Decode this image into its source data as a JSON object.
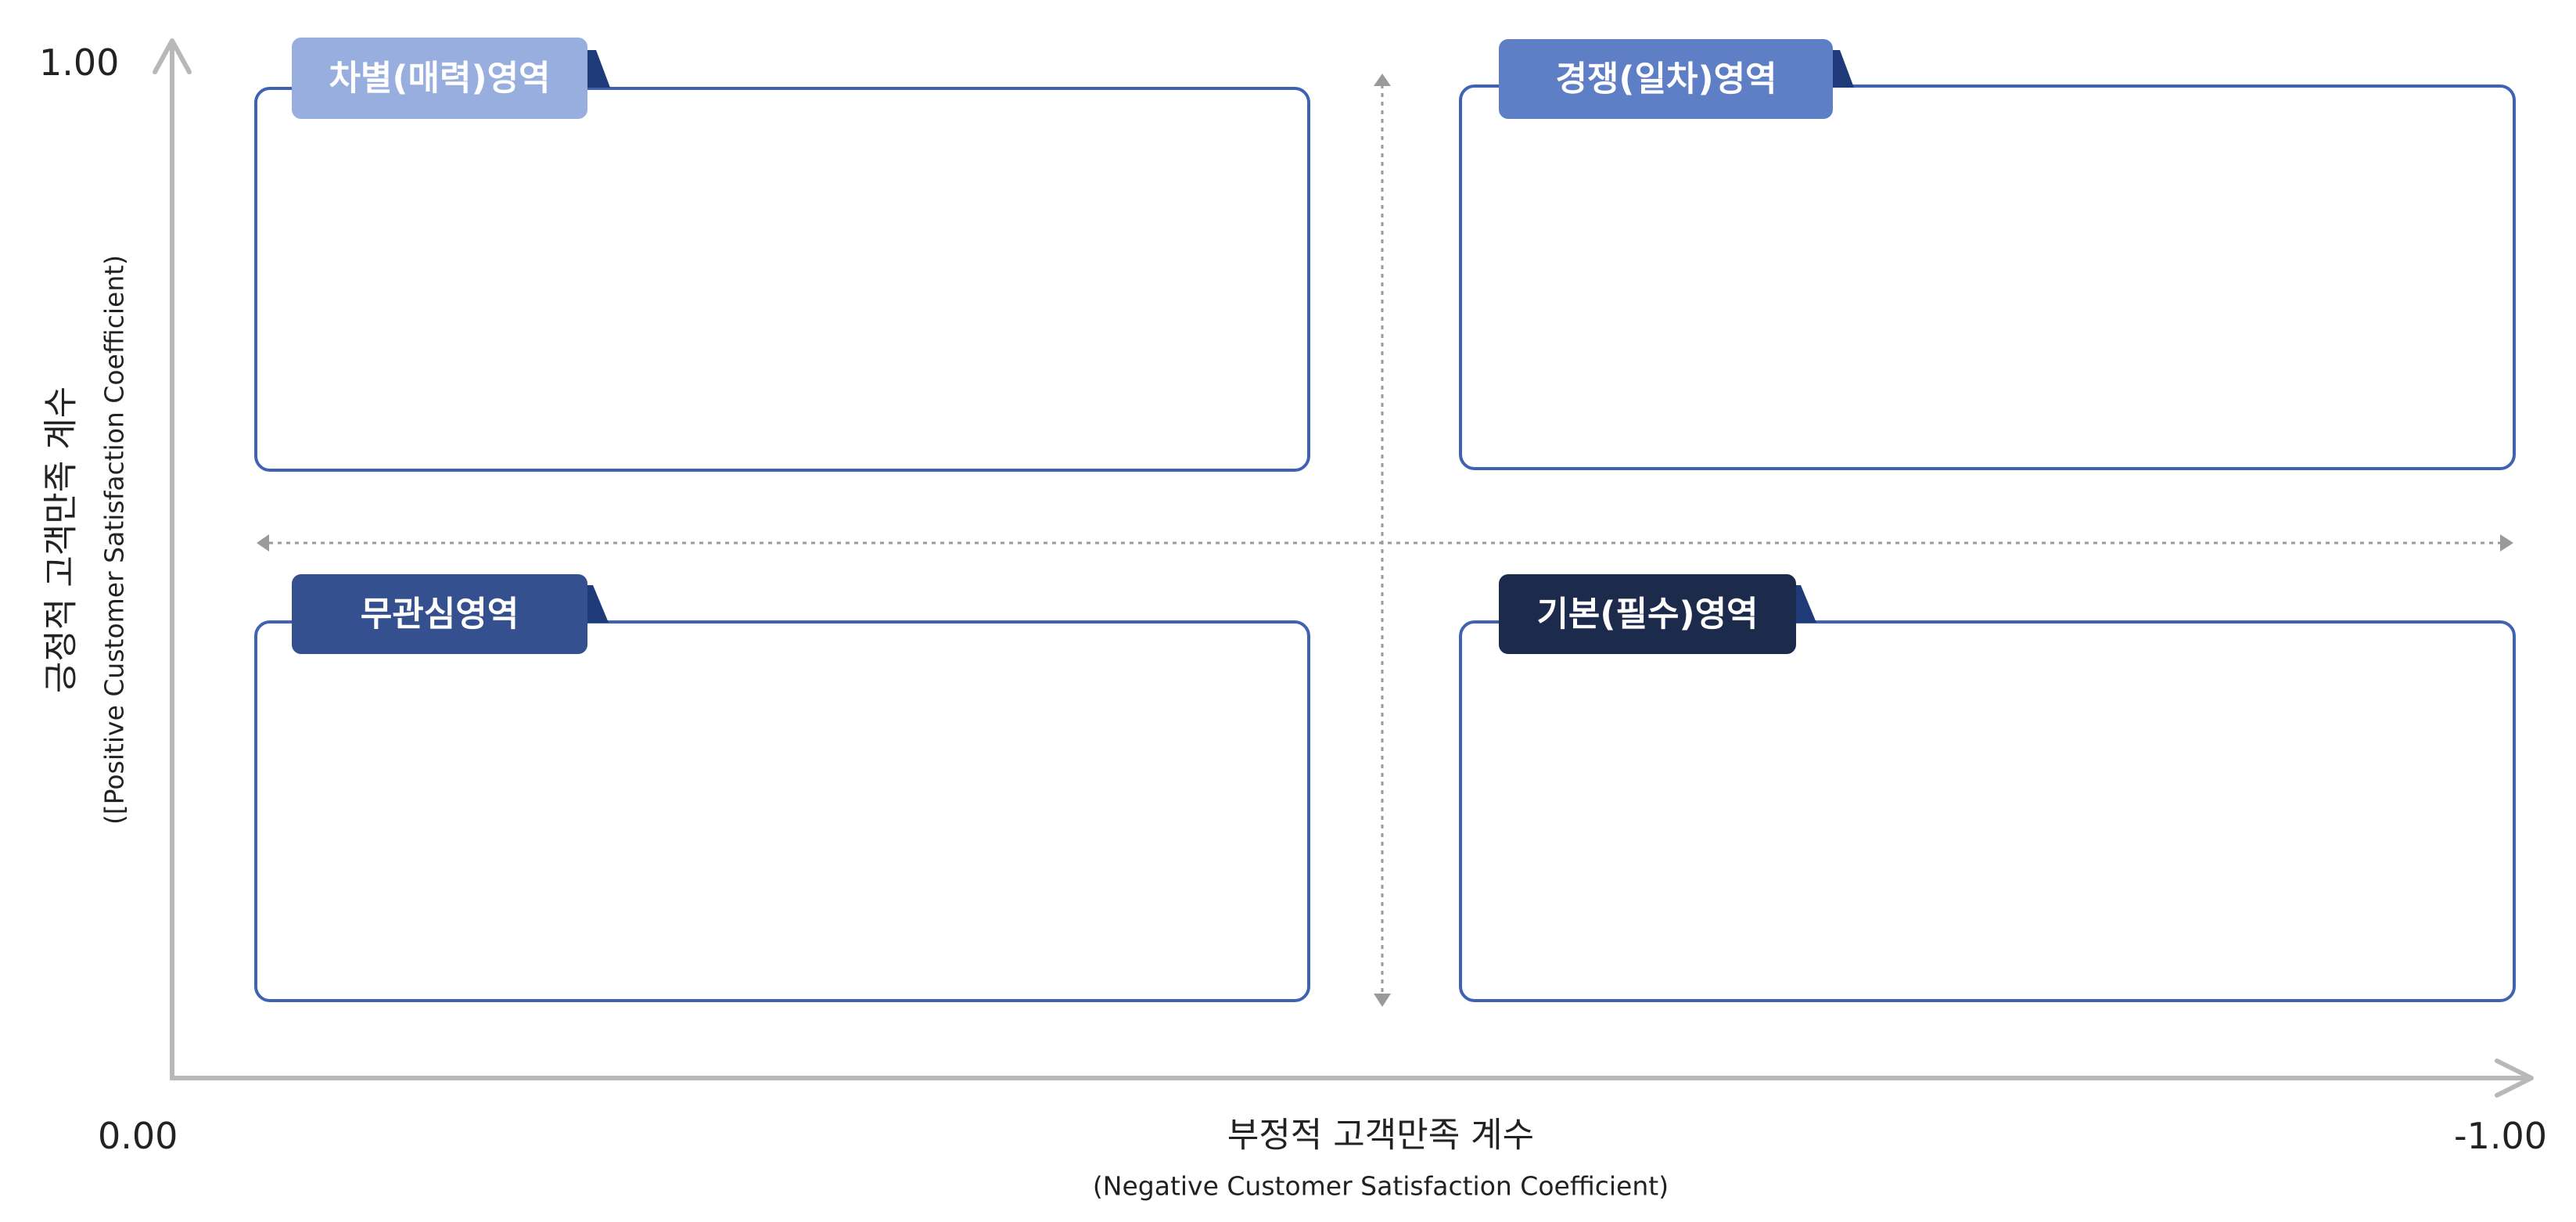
{
  "axes": {
    "y_max_label": "1.00",
    "origin_label": "0.00",
    "x_max_label": "-1.00",
    "y_title_ko": "긍정적 고객만족 계수",
    "y_title_en": "([Positive Customer Satisfaction Coefficient)",
    "x_title_ko": "부정적 고객만족 계수",
    "x_title_en": "(Negative Customer Satisfaction Coefficient)"
  },
  "quadrants": {
    "top_left": {
      "label": "차별(매력)영역",
      "color": "#97AEDF"
    },
    "top_right": {
      "label": "경쟁(일차)영역",
      "color": "#5E7EC6"
    },
    "bottom_left": {
      "label": "무관심영역",
      "color": "#34508F"
    },
    "bottom_right": {
      "label": "기본(필수)영역",
      "color": "#1C2A4B"
    }
  },
  "colors": {
    "box_border": "#3F62B2",
    "axis": "#B8B8B8",
    "divider": "#9A9A9A",
    "tab_fold": "#1F3A78"
  }
}
